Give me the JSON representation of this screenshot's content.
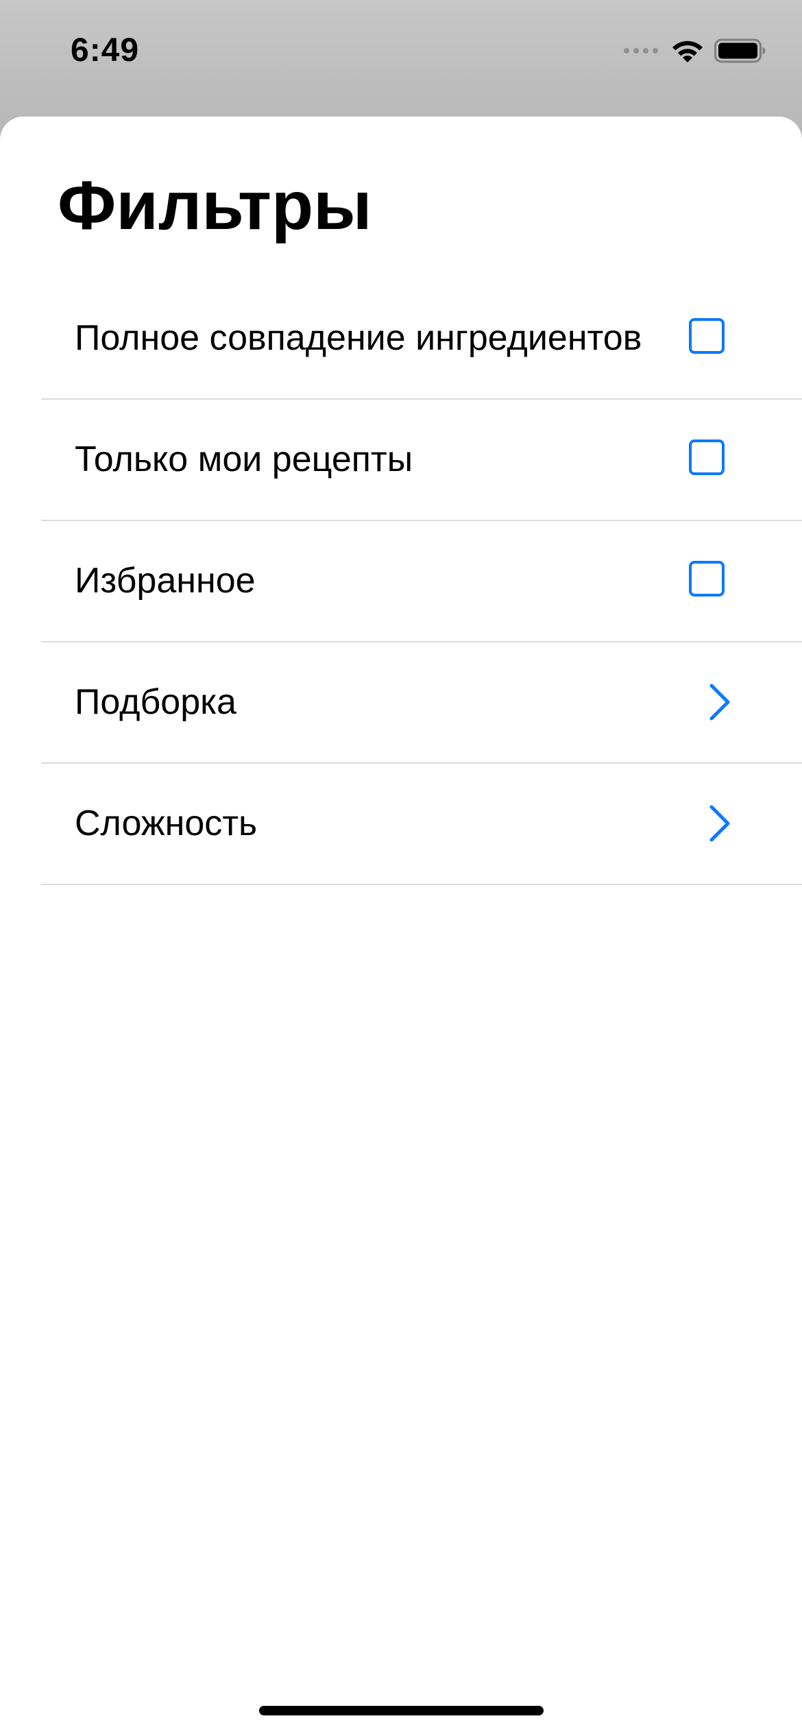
{
  "status_bar": {
    "time": "6:49",
    "icons": [
      "signal-icon",
      "wifi-icon",
      "battery-icon"
    ]
  },
  "sheet": {
    "title": "Фильтры"
  },
  "filters": [
    {
      "label": "Полное совпадение ингредиентов",
      "control": "checkbox",
      "checked": false
    },
    {
      "label": "Только мои рецепты",
      "control": "checkbox",
      "checked": false
    },
    {
      "label": "Избранное",
      "control": "checkbox",
      "checked": false
    },
    {
      "label": "Подборка",
      "control": "chevron-right-icon"
    },
    {
      "label": "Сложность",
      "control": "chevron-right-icon"
    }
  ],
  "colors": {
    "accent": "#0a7aff",
    "separator": "#dcdcde",
    "backdrop": "#c0c1c0"
  }
}
